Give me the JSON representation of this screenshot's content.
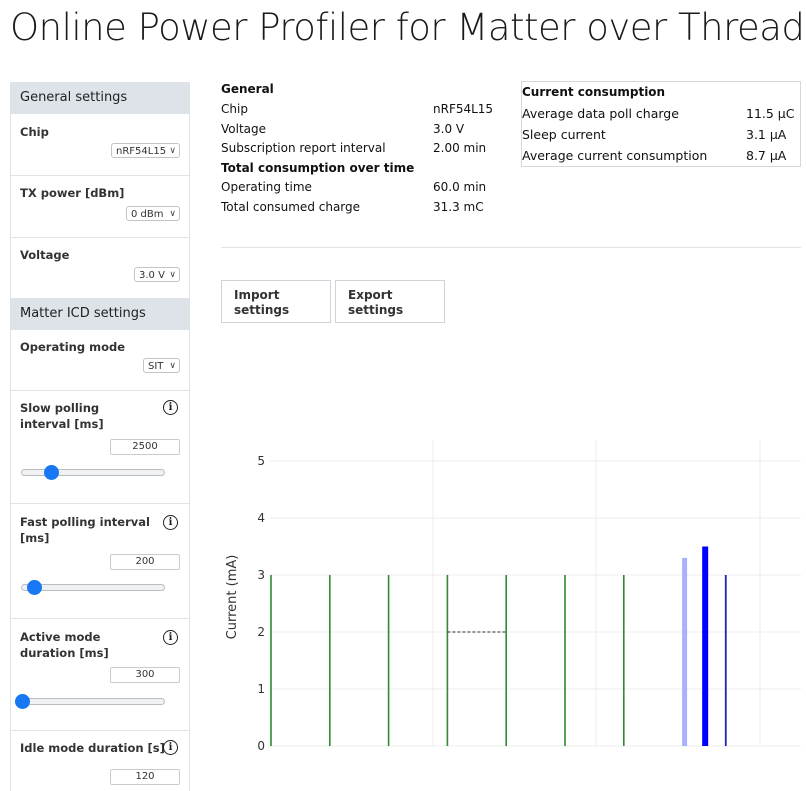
{
  "title": "Online Power Profiler for Matter over Thread",
  "sidebar": {
    "general_header": "General settings",
    "chip": {
      "label": "Chip",
      "value": "nRF54L15"
    },
    "tx_power": {
      "label": "TX power [dBm]",
      "value": "0 dBm"
    },
    "voltage": {
      "label": "Voltage",
      "value": "3.0 V"
    },
    "icd_header": "Matter ICD settings",
    "operating_mode": {
      "label": "Operating mode",
      "value": "SIT"
    },
    "slow_polling": {
      "label": "Slow polling interval [ms]",
      "value": "2500",
      "slider_fraction": 0.2
    },
    "fast_polling": {
      "label": "Fast polling interval [ms]",
      "value": "200",
      "slider_fraction": 0.08
    },
    "active_mode": {
      "label": "Active mode duration [ms]",
      "value": "300",
      "slider_fraction": 0.0
    },
    "idle_mode": {
      "label": "Idle mode duration [s]",
      "value": "120"
    }
  },
  "general": {
    "header": "General",
    "rows": [
      {
        "label": "Chip",
        "value": "nRF54L15"
      },
      {
        "label": "Voltage",
        "value": "3.0 V"
      },
      {
        "label": "Subscription report interval",
        "value": "2.00 min"
      }
    ],
    "total_header": "Total consumption over time",
    "total_rows": [
      {
        "label": "Operating time",
        "value": "60.0 min"
      },
      {
        "label": "Total consumed charge",
        "value": "31.3 mC"
      }
    ]
  },
  "current_consumption": {
    "header": "Current consumption",
    "rows": [
      {
        "label": "Average data poll charge",
        "value": "11.5 µC"
      },
      {
        "label": "Sleep current",
        "value": "3.1 µA"
      },
      {
        "label": "Average current consumption",
        "value": "8.7 µA"
      }
    ]
  },
  "buttons": {
    "import": "Import settings",
    "export": "Export settings"
  },
  "chart_data": {
    "type": "bar",
    "ylabel": "Current (mA)",
    "xlabel": "",
    "ylim": [
      0,
      5.2
    ],
    "yticks": [
      0,
      1,
      2,
      3,
      4,
      5
    ],
    "grid": true,
    "series": [
      {
        "kind": "poll-spikes",
        "color": "#2e8b2e",
        "x": [
          0,
          1,
          2,
          3,
          4,
          5,
          6
        ],
        "values": [
          3,
          3,
          3,
          3,
          3,
          3,
          3
        ]
      },
      {
        "kind": "dashed-level",
        "color": "#555555",
        "x_range": [
          3,
          4
        ],
        "value": 2
      },
      {
        "kind": "report-bars",
        "colors": [
          "#aab0ff",
          "#0000ff",
          "#2222aa"
        ],
        "x": [
          7.0,
          7.35,
          7.7
        ],
        "values": [
          3.3,
          3.5,
          3.0
        ]
      }
    ]
  }
}
